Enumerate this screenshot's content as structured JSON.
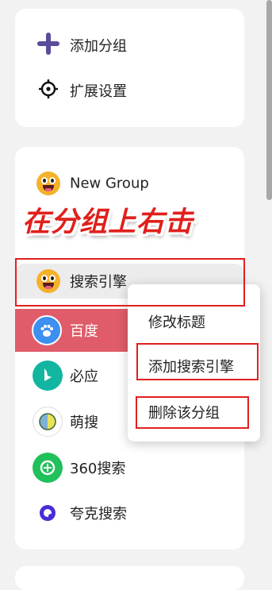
{
  "top_menu": {
    "add_group": "添加分组",
    "ext_settings": "扩展设置"
  },
  "groups": {
    "new_group": "New Group",
    "search_group": "搜索引擎"
  },
  "annotation_banner": "在分组上右击",
  "engines": [
    {
      "label": "百度",
      "icon": "baidu-paw-icon"
    },
    {
      "label": "必应",
      "icon": "bing-icon"
    },
    {
      "label": "萌搜",
      "icon": "mengsou-icon"
    },
    {
      "label": "360搜索",
      "icon": "360-search-icon"
    },
    {
      "label": "夸克搜索",
      "icon": "quark-icon"
    }
  ],
  "context_menu": {
    "rename": "修改标题",
    "add_engine": "添加搜索引擎",
    "delete_group": "删除该分组"
  },
  "colors": {
    "active_row": "#e05c6a",
    "annotation_red": "#e02020",
    "accent_purple": "#5b4b9a"
  }
}
